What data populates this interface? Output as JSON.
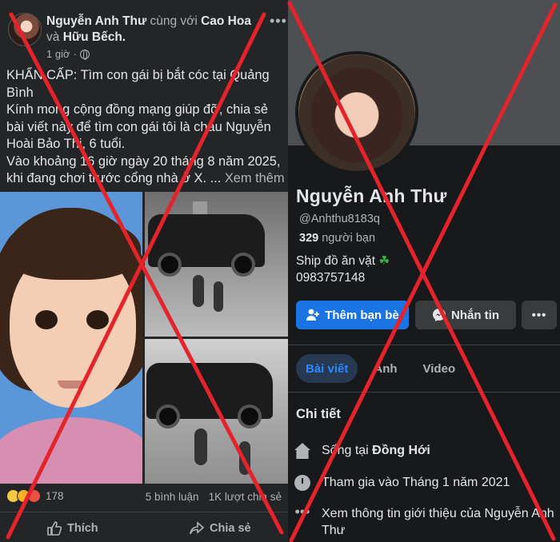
{
  "post": {
    "author": "Nguyễn Anh Thư",
    "with_word": "cùng với",
    "tagged_1": "Cao Hoa",
    "and_word": "và",
    "tagged_2": "Hữu Bếch.",
    "time": "1 giờ",
    "text_lines": [
      "KHẨN CẤP: Tìm con gái bị bắt cóc tại Quảng Bình",
      "Kính mong cộng đồng mạng giúp đỡ, chia sẻ bài viết này để tìm con gái tôi là cháu Nguyễn Hoài Bảo Thi, 6 tuổi.",
      "Vào khoảng 16 giờ ngày 20 tháng 8 năm 2025, khi đang chơi trước cổng nhà ở X. ..."
    ],
    "see_more": "Xem thêm",
    "reaction_count": "178",
    "comments": "5 bình luận",
    "shares": "1K lượt chia sẻ",
    "like_label": "Thích",
    "share_label": "Chia sẻ"
  },
  "profile": {
    "name": "Nguyễn Anh Thư",
    "handle": "@Anhthu8183q",
    "friend_count": "329",
    "friend_word": "người bạn",
    "bio_line1": "Ship đồ ăn vặt",
    "bio_emoji": "☘",
    "bio_line2": "0983757148",
    "add_friend_label": "Thêm bạn bè",
    "message_label": "Nhắn tin",
    "more_label": "•••",
    "tabs": [
      "Bài viết",
      "Ảnh",
      "Video"
    ],
    "details_title": "Chi tiết",
    "lives_prefix": "Sống tại",
    "lives_city": "Đồng Hới",
    "joined": "Tham gia vào Tháng 1 năm 2021",
    "about": "Xem thông tin giới thiệu của Nguyễn Anh Thư"
  },
  "colors": {
    "cross": "#e5232b",
    "accent": "#1b74e4",
    "panel_left": "#242526",
    "panel_right": "#18191a"
  }
}
